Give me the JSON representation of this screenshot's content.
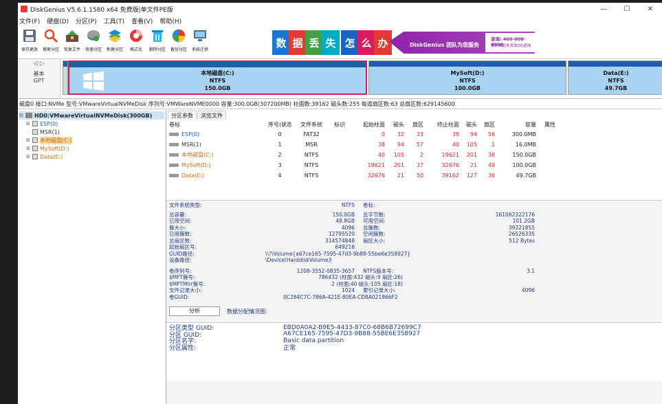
{
  "window": {
    "title": "DiskGenius V5.6.1.1580 x64 免费版|单文件PE版",
    "minimize": "—",
    "maximize": "☐",
    "close": "✕"
  },
  "menu": [
    "文件(F)",
    "硬盘(D)",
    "分区(P)",
    "工具(T)",
    "查看(V)",
    "帮助(H)"
  ],
  "toolbar": [
    {
      "label": "保存更改",
      "icon": "save-icon"
    },
    {
      "label": "搜索分区",
      "icon": "search-icon"
    },
    {
      "label": "恢复文件",
      "icon": "recover-icon"
    },
    {
      "label": "快速分区",
      "icon": "quick-partition-icon"
    },
    {
      "label": "新建分区",
      "icon": "new-partition-icon"
    },
    {
      "label": "格式化",
      "icon": "format-icon"
    },
    {
      "label": "删除分区",
      "icon": "delete-icon"
    },
    {
      "label": "备份分区",
      "icon": "backup-icon"
    },
    {
      "label": "系统迁移",
      "icon": "migrate-icon"
    }
  ],
  "banner": {
    "tiles": [
      "数",
      "据",
      "丢",
      "失",
      "怎",
      "么",
      "办"
    ],
    "colors": [
      "#1976d2",
      "#e53935",
      "#43a047",
      "#00acc1",
      "#1565c0",
      "#d81b60",
      "#e53935"
    ],
    "ad_text": "DiskGenius 团队为您服务",
    "phone": "咨询: 400-008-9958",
    "qq": "或点击此处添加QQ咨询"
  },
  "diskmap": {
    "arrows": "◁ ▷",
    "type": "基本",
    "style": "GPT",
    "partitions": [
      {
        "name": "本地磁盘(C:)",
        "fs": "NTFS",
        "size": "150.0GB",
        "selected": true
      },
      {
        "name": "MySoft(D:)",
        "fs": "NTFS",
        "size": "100.0GB",
        "selected": false
      },
      {
        "name": "Data(E:)",
        "fs": "NTFS",
        "size": "49.7GB",
        "selected": false
      }
    ]
  },
  "disk_info": "磁盘0 接口:NVMe  型号:VMwareVirtualNVMeDisk  序列号:VMWareNVME0000  容量:300.0GB(307200MB)  柱面数:39162  磁头数:255  每道扇区数:63  总扇区数:629145600",
  "tree": {
    "disk": "HD0:VMwareVirtualNVMeDisk(300GB)",
    "partitions": [
      {
        "name": "ESP(0)",
        "color": "blue"
      },
      {
        "name": "MSR(1)",
        "color": "dark"
      },
      {
        "name": "本地磁盘(C:)",
        "color": "sel"
      },
      {
        "name": "MySoft(D:)",
        "color": "orange"
      },
      {
        "name": "Data(E:)",
        "color": "orange"
      }
    ]
  },
  "tabs": [
    "分区参数",
    "浏览文件"
  ],
  "table": {
    "headers": [
      "卷标",
      "序号(状态)",
      "文件系统",
      "标识",
      "起始柱面",
      "磁头",
      "扇区",
      "终止柱面",
      "磁头",
      "扇区",
      "容量",
      "属性"
    ],
    "rows": [
      {
        "label": "ESP(0)",
        "color": "blue",
        "cells": [
          "0",
          "FAT32",
          "",
          "0",
          "32",
          "33",
          "38",
          "94",
          "56",
          "300.0MB",
          ""
        ]
      },
      {
        "label": "MSR(1)",
        "color": "dark",
        "cells": [
          "1",
          "MSR",
          "",
          "38",
          "94",
          "57",
          "40",
          "105",
          "1",
          "16.0MB",
          ""
        ]
      },
      {
        "label": "本地磁盘(C:)",
        "color": "orange",
        "cells": [
          "2",
          "NTFS",
          "",
          "40",
          "105",
          "2",
          "19621",
          "201",
          "36",
          "150.0GB",
          ""
        ]
      },
      {
        "label": "MySoft(D:)",
        "color": "orange",
        "cells": [
          "3",
          "NTFS",
          "",
          "19621",
          "201",
          "37",
          "32676",
          "21",
          "49",
          "100.0GB",
          ""
        ]
      },
      {
        "label": "Data(E:)",
        "color": "orange",
        "cells": [
          "4",
          "NTFS",
          "",
          "32676",
          "21",
          "50",
          "39162",
          "127",
          "36",
          "49.7GB",
          ""
        ]
      }
    ]
  },
  "details": {
    "fs_type_label": "文件系统类型:",
    "fs_type": "NTFS",
    "vol_label": "卷标:",
    "pairs": [
      [
        "总容量:",
        "150.0GB",
        "总字节数:",
        "161062322176"
      ],
      [
        "已用空间:",
        "48.8GB",
        "可用空间:",
        "101.2GB"
      ],
      [
        "簇大小:",
        "4096",
        "总簇数:",
        "39321855"
      ],
      [
        "已用簇数:",
        "12795520",
        "空闲簇数:",
        "26526335"
      ],
      [
        "总扇区数:",
        "314574848",
        "扇区大小:",
        "512 Bytes"
      ],
      [
        "起始扇区号:",
        "649216",
        "",
        ""
      ]
    ],
    "guid_path_label": "GUID路径:",
    "guid_path": "\\\\?\\Volume{a67ce165-7595-47d3-9b88-55be6e358927}",
    "device_path_label": "设备路径:",
    "device_path": "\\Device\\HarddiskVolume3",
    "serial_label": "卷序列号:",
    "serial": "1208-3552-0835-3657",
    "ntfs_ver_label": "NTFS版本号:",
    "ntfs_ver": "3.1",
    "mft_label": "$MFT簇号:",
    "mft": "786432 (柱面:432 磁头:9 扇区:26)",
    "mftmirr_label": "$MFTMirr簇号:",
    "mftmirr": "2 (柱面:40 磁头:105 扇区:18)",
    "record_label": "文件记录大小:",
    "record": "1024",
    "index_label": "索引记录大小:",
    "index": "4096",
    "volguid_label": "卷GUID:",
    "volguid": "0C284C7C-786A-421E-80EA-CD8A021866F2"
  },
  "analyze": {
    "button": "分析",
    "label": "数据分配情况图:"
  },
  "guids": [
    [
      "分区类型 GUID:",
      "EBD0A0A2-B9E5-4433-87C0-68B6B72699C7"
    ],
    [
      "分区 GUID:",
      "A67CE165-7595-47D3-9B88-55BE6E358927"
    ],
    [
      "分区名字:",
      "Basic data partition"
    ],
    [
      "分区属性:",
      "正常"
    ]
  ]
}
